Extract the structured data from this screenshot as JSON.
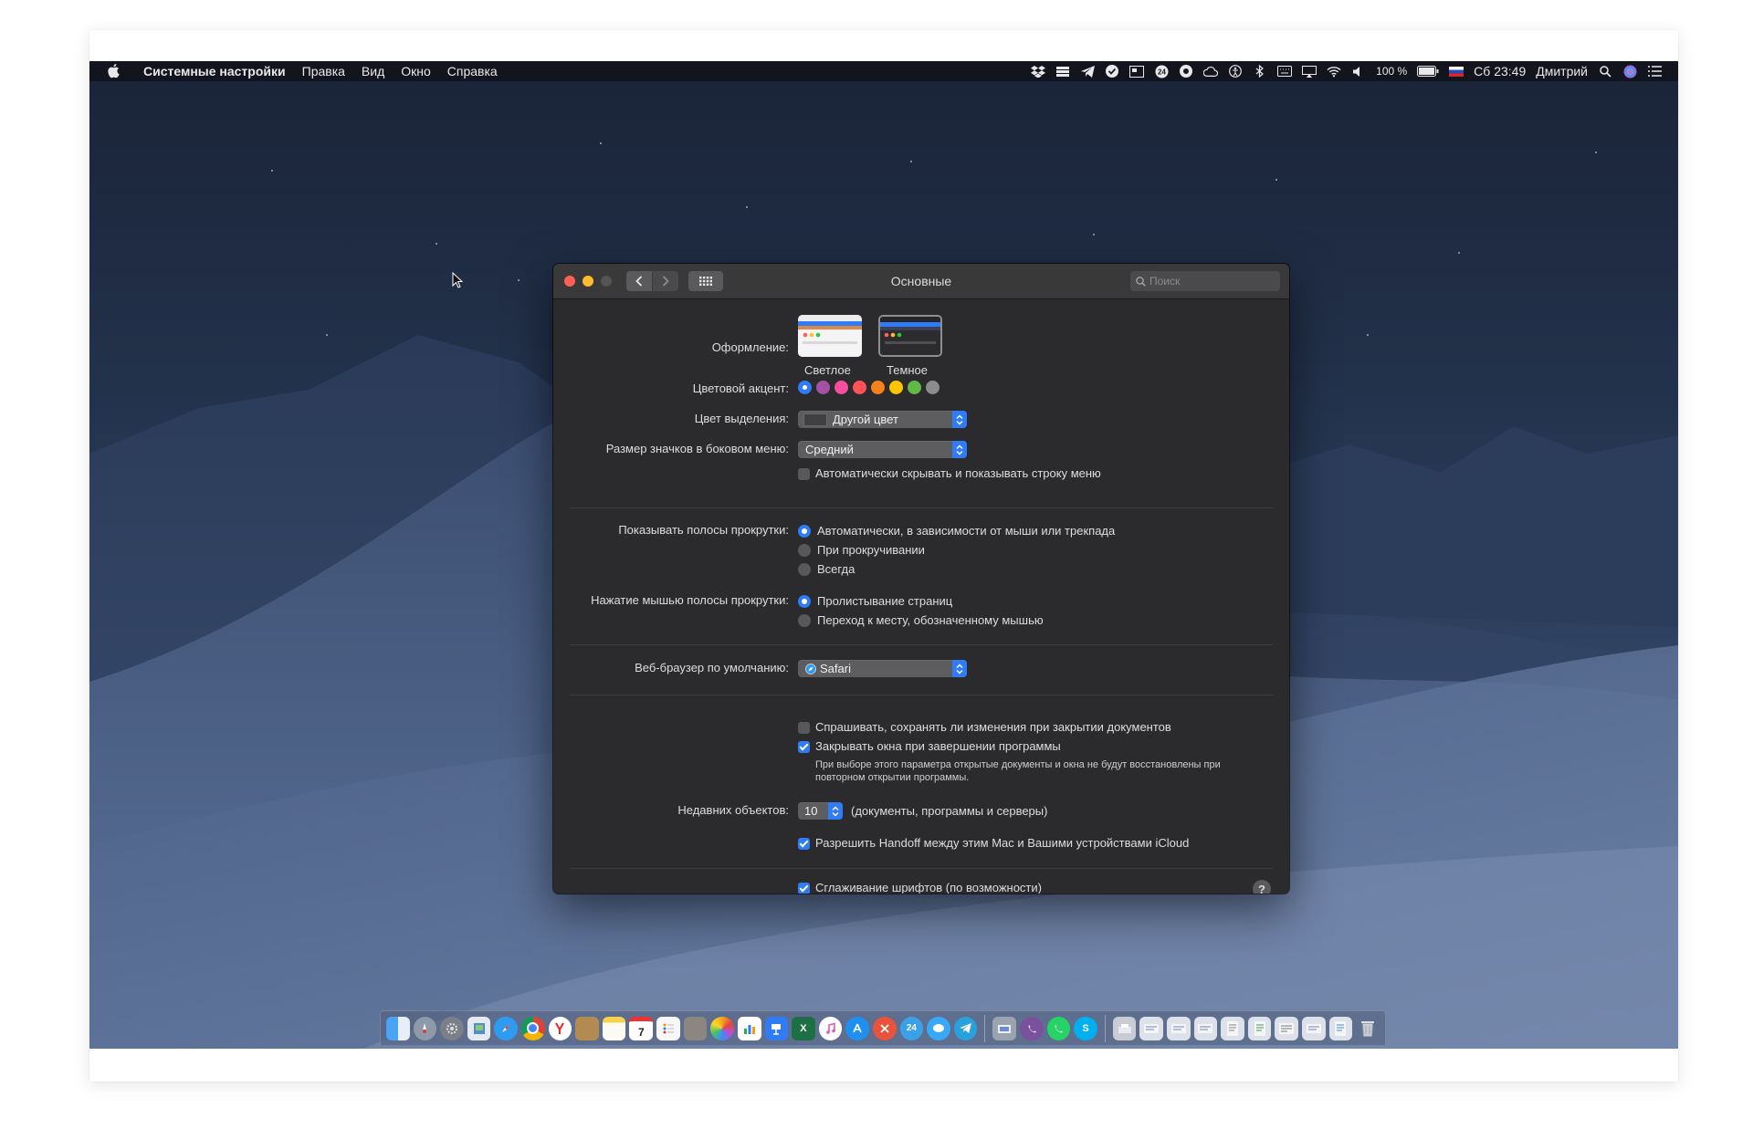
{
  "menubar": {
    "app_name": "Системные настройки",
    "menus": [
      "Правка",
      "Вид",
      "Окно",
      "Справка"
    ],
    "battery": "100 %",
    "clock": "Сб 23:49",
    "user": "Дмитрий",
    "status_icons": [
      "dropbox-icon",
      "stack-icon",
      "telegram-icon",
      "check-icon",
      "screen-icon",
      "24-icon",
      "viber-icon",
      "cloud-icon",
      "accessibility-icon",
      "bluetooth-icon",
      "keyboard-icon",
      "airplay-icon",
      "wifi-icon",
      "volume-icon",
      "battery-icon",
      "flag-ru-icon",
      "search-icon",
      "siri-icon",
      "list-icon"
    ],
    "status_badges": {
      "badge_24": "24"
    }
  },
  "window": {
    "title": "Основные",
    "search_placeholder": "Поиск",
    "appearance": {
      "label": "Оформление:",
      "options": [
        {
          "label": "Светлое",
          "selected": false
        },
        {
          "label": "Темное",
          "selected": true
        }
      ]
    },
    "accent": {
      "label": "Цветовой акцент:",
      "colors": [
        "#2f7cf6",
        "#a550a7",
        "#f74f9e",
        "#ff5257",
        "#f7821b",
        "#ffc600",
        "#62ba46",
        "#8c8c8c"
      ],
      "selected_index": 0
    },
    "highlight": {
      "label": "Цвет выделения:",
      "value": "Другой цвет"
    },
    "sidebar_icon_size": {
      "label": "Размер значков в боковом меню:",
      "value": "Средний"
    },
    "auto_hide_menu": {
      "label": "Автоматически скрывать и показывать строку меню",
      "checked": false
    },
    "show_scrollbars": {
      "label": "Показывать полосы прокрутки:",
      "options": [
        {
          "label": "Автоматически, в зависимости от мыши или трекпада",
          "selected": true
        },
        {
          "label": "При прокручивании",
          "selected": false
        },
        {
          "label": "Всегда",
          "selected": false
        }
      ]
    },
    "scrollbar_click": {
      "label": "Нажатие мышью полосы прокрутки:",
      "options": [
        {
          "label": "Пролистывание страниц",
          "selected": true
        },
        {
          "label": "Переход к месту, обозначенному мышью",
          "selected": false
        }
      ]
    },
    "browser": {
      "label": "Веб-браузер по умолчанию:",
      "value": "Safari"
    },
    "ask_save": {
      "label": "Спрашивать, сохранять ли изменения при закрытии документов",
      "checked": false
    },
    "close_windows": {
      "label": "Закрывать окна при завершении программы",
      "checked": true,
      "note_line1": "При выборе этого параметра открытые документы и окна не будут восстановлены при",
      "note_line2": "повторном открытии программы."
    },
    "recent_items": {
      "label": "Недавних объектов:",
      "value": "10",
      "suffix": "(документы, программы и серверы)"
    },
    "handoff": {
      "label": "Разрешить Handoff между этим Mac и Вашими устройствами iCloud",
      "checked": true
    },
    "font_smoothing": {
      "label": "Сглаживание шрифтов (по возможности)",
      "checked": true
    },
    "help_glyph": "?"
  },
  "dock": {
    "items": [
      "finder",
      "launchpad",
      "system-preferences",
      "preview",
      "safari",
      "chrome",
      "yandex",
      "notes-app",
      "notes",
      "calendar",
      "reminders",
      "books",
      "photos",
      "numbers",
      "keynote",
      "excel",
      "itunes",
      "app-store",
      "toolbox",
      "24-app",
      "messages",
      "telegram",
      "spacer",
      "image-capture",
      "viber",
      "whatsapp",
      "skype",
      "spacer",
      "downloads",
      "doc-1",
      "doc-2",
      "doc-3",
      "doc-4",
      "doc-5",
      "doc-6",
      "doc-7",
      "doc-8",
      "trash"
    ],
    "calendar_day": "7",
    "badge_24": "24",
    "skype_letter": "S",
    "excel_letter": "X"
  },
  "colors": {
    "accent_blue": "#2f7cf6",
    "window_bg": "#2b2b2d",
    "titlebar": "#393939"
  }
}
